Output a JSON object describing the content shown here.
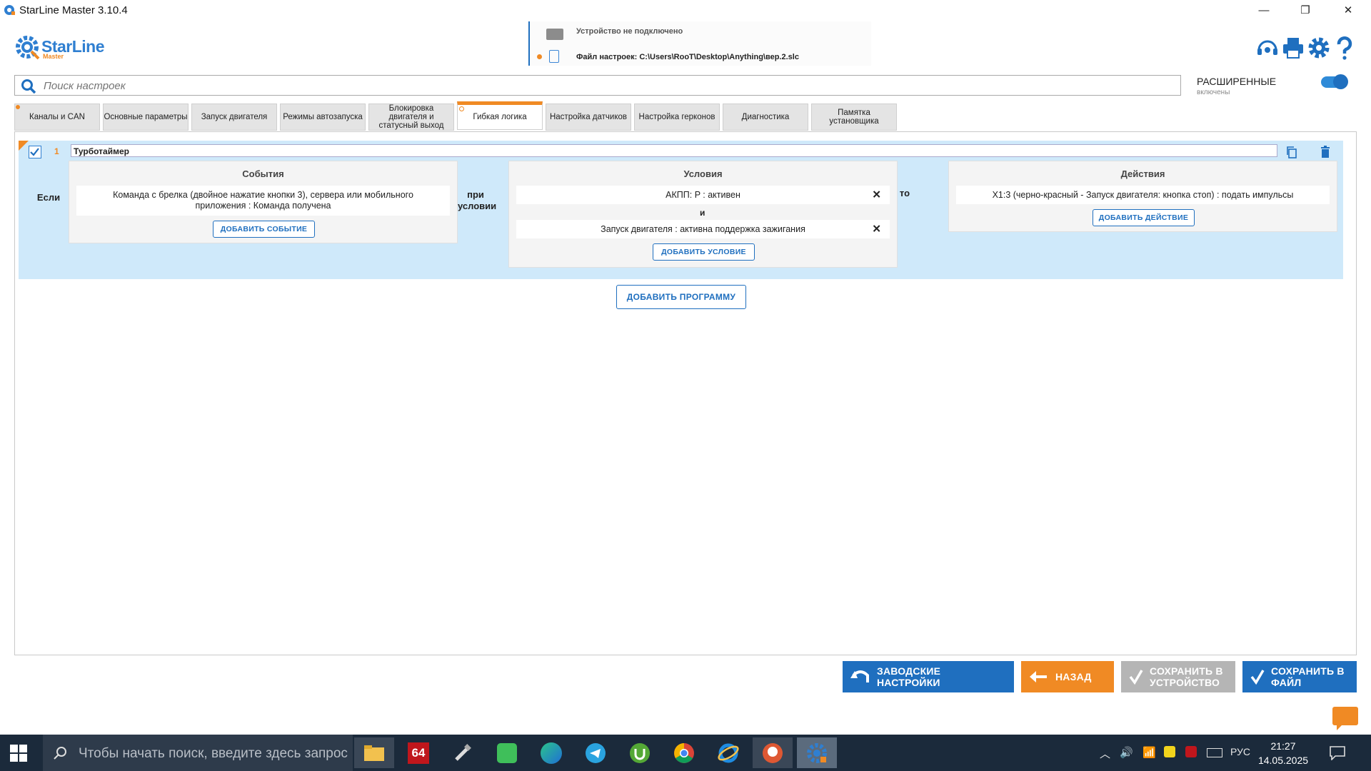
{
  "window": {
    "title": "StarLine Master 3.10.4",
    "minimize_glyph": "—",
    "maximize_glyph": "❐",
    "close_glyph": "✕"
  },
  "header": {
    "logo_text": "StarLine",
    "logo_sub": "Master",
    "device_status": "Устройство не подключено",
    "settings_file": "Файл настроек: C:\\Users\\RooT\\Desktop\\Anything\\вер.2.slc",
    "icons": [
      "support-headset-icon",
      "printer-icon",
      "gear-icon",
      "help-icon"
    ]
  },
  "search": {
    "placeholder": "Поиск настроек"
  },
  "advanced": {
    "label": "РАСШИРЕННЫЕ",
    "state": "включены",
    "enabled": true
  },
  "tabs": [
    {
      "label": "Каналы и CAN",
      "marked": true
    },
    {
      "label": "Основные параметры"
    },
    {
      "label": "Запуск двигателя"
    },
    {
      "label": "Режимы автозапуска"
    },
    {
      "label": "Блокировка двигателя и статусный выход"
    },
    {
      "label": "Гибкая логика",
      "active": true,
      "marked": true
    },
    {
      "label": "Настройка датчиков"
    },
    {
      "label": "Настройка герконов"
    },
    {
      "label": "Диагностика"
    },
    {
      "label": "Памятка установщика"
    }
  ],
  "program": {
    "number": "1",
    "name": "Турботаймер",
    "enabled": true,
    "if_label": "Если",
    "under_condition_label": "при условии",
    "then_label": "то",
    "events": {
      "title": "События",
      "items": [
        "Команда с брелка (двойное нажатие кнопки 3), сервера или мобильного приложения : Команда получена"
      ],
      "add_button": "ДОБАВИТЬ СОБЫТИЕ"
    },
    "conditions": {
      "title": "Условия",
      "items": [
        "АКПП: P : активен",
        "Запуск двигателя : активна поддержка зажигания"
      ],
      "joiner": "и",
      "add_button": "ДОБАВИТЬ УСЛОВИЕ"
    },
    "actions": {
      "title": "Действия",
      "items": [
        "X1:3 (черно-красный - Запуск двигателя: кнопка стоп) : подать импульсы"
      ],
      "add_button": "ДОБАВИТЬ ДЕЙСТВИЕ"
    }
  },
  "add_program_button": "ДОБАВИТЬ ПРОГРАММУ",
  "bottom_buttons": {
    "factory": "ЗАВОДСКИЕ НАСТРОЙКИ",
    "back": "НАЗАД",
    "save_device": "СОХРАНИТЬ В УСТРОЙСТВО",
    "save_file": "СОХРАНИТЬ В ФАЙЛ"
  },
  "colors": {
    "accent_blue": "#1f6fbf",
    "accent_orange": "#f08a24",
    "program_bg": "#cfe9fa",
    "disabled_gray": "#b5b5b5"
  },
  "taskbar": {
    "search_placeholder": "Чтобы начать поиск, введите здесь запрос",
    "apps": [
      "file-explorer-icon",
      "aida64-icon",
      "tool-icon",
      "calendar-app-icon",
      "edge-icon",
      "telegram-icon",
      "utorrent-icon",
      "chrome-icon",
      "internet-explorer-icon",
      "duckduckgo-icon",
      "starline-master-icon"
    ],
    "app_64_label": "64",
    "language": "РУС",
    "time": "21:27",
    "date": "14.05.2025"
  }
}
